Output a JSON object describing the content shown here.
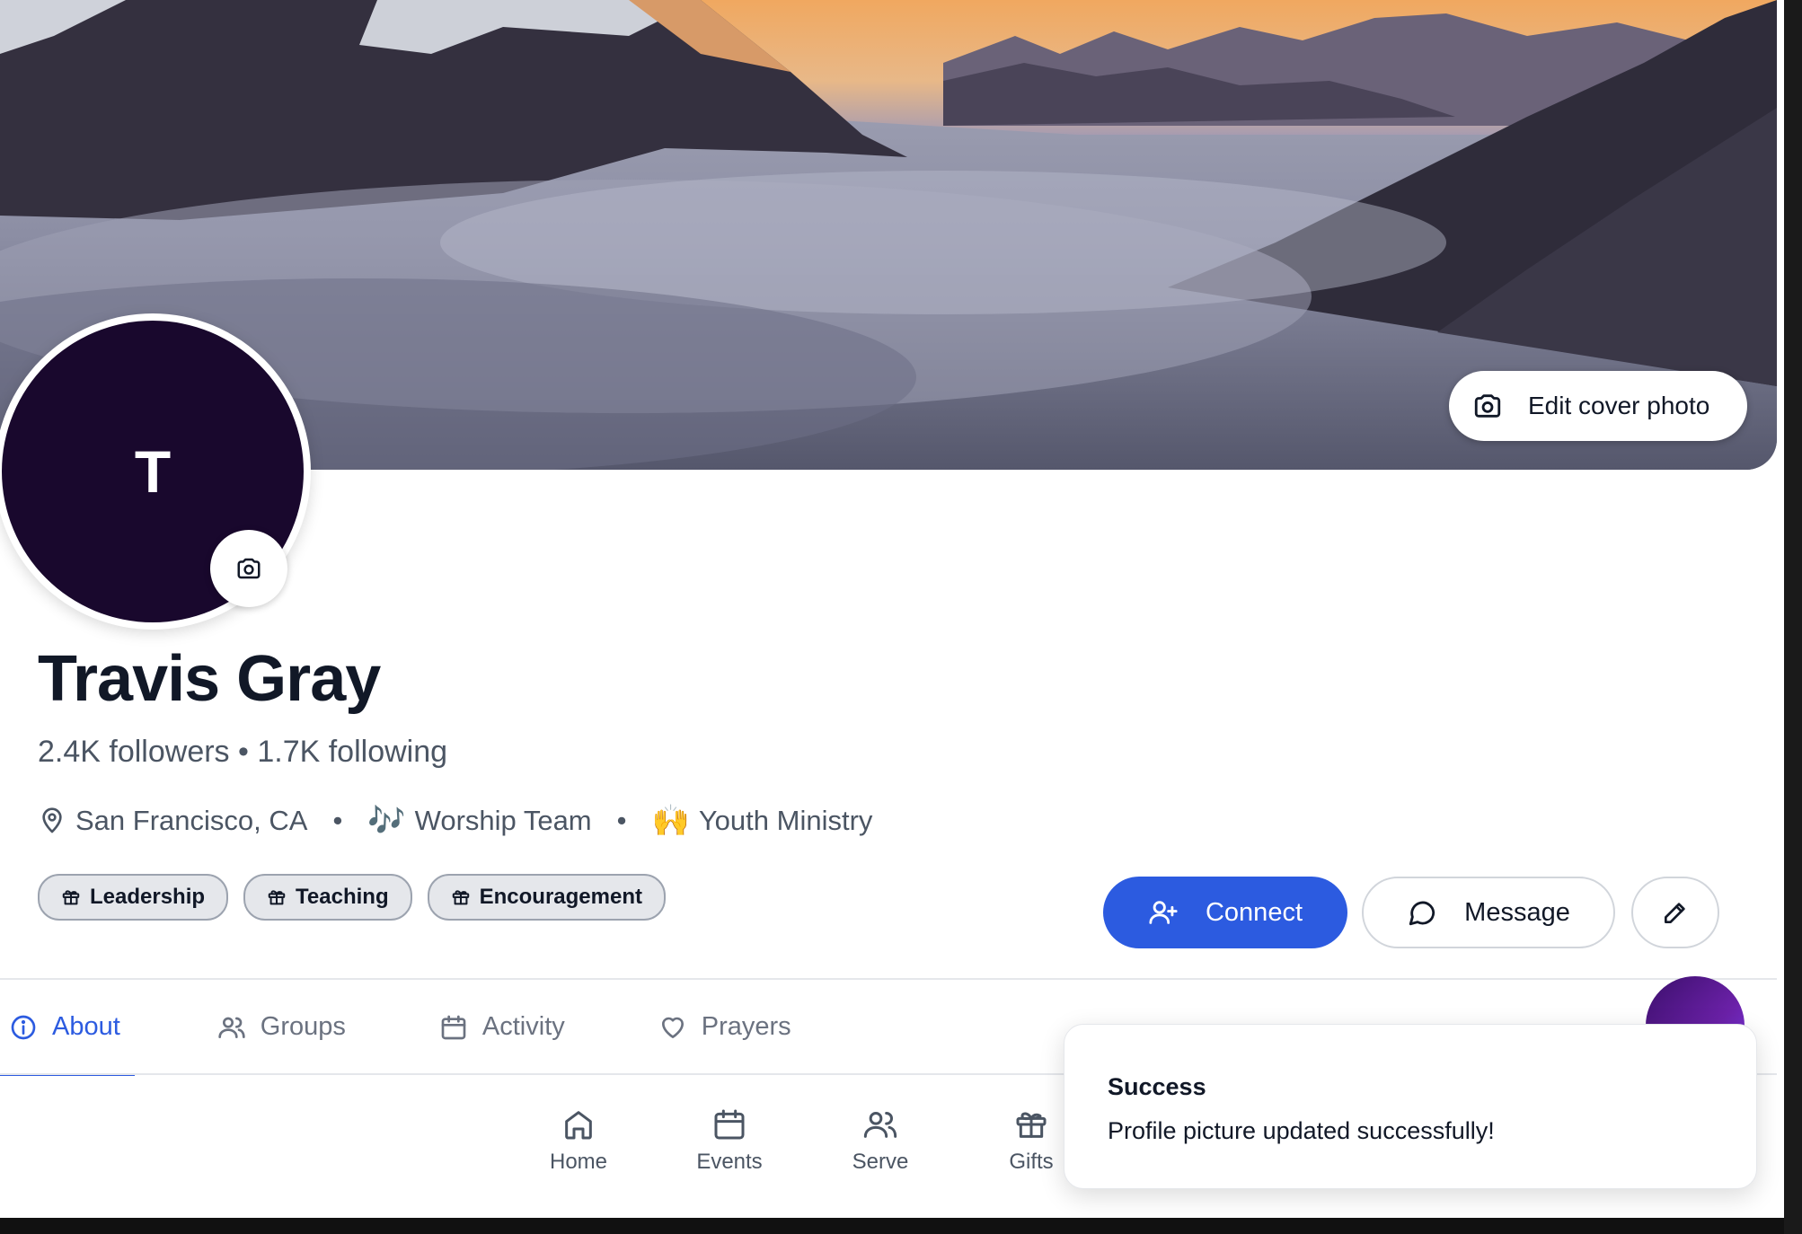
{
  "cover": {
    "edit_label": "Edit cover photo"
  },
  "profile": {
    "initial": "T",
    "name": "Travis Gray",
    "stats": "2.4K followers • 1.7K following",
    "location": "San Francisco, CA",
    "separator": "•",
    "team_emoji": "🎶",
    "team": "Worship Team",
    "ministry_emoji": "🙌",
    "ministry": "Youth Ministry",
    "gifts": [
      {
        "label": "Leadership"
      },
      {
        "label": "Teaching"
      },
      {
        "label": "Encouragement"
      }
    ]
  },
  "actions": {
    "connect_label": "Connect",
    "message_label": "Message"
  },
  "tabs": [
    {
      "label": "About",
      "active": true
    },
    {
      "label": "Groups",
      "active": false
    },
    {
      "label": "Activity",
      "active": false
    },
    {
      "label": "Prayers",
      "active": false
    }
  ],
  "bottom_nav": [
    {
      "label": "Home",
      "icon": "home-icon"
    },
    {
      "label": "Events",
      "icon": "calendar-icon"
    },
    {
      "label": "Serve",
      "icon": "users-icon"
    },
    {
      "label": "Gifts",
      "icon": "gift-icon"
    }
  ],
  "toast": {
    "title": "Success",
    "message": "Profile picture updated successfully!"
  },
  "colors": {
    "accent": "#2c5be0",
    "avatar_bg": "#19082d",
    "text": "#111827",
    "muted": "#4b5563"
  }
}
